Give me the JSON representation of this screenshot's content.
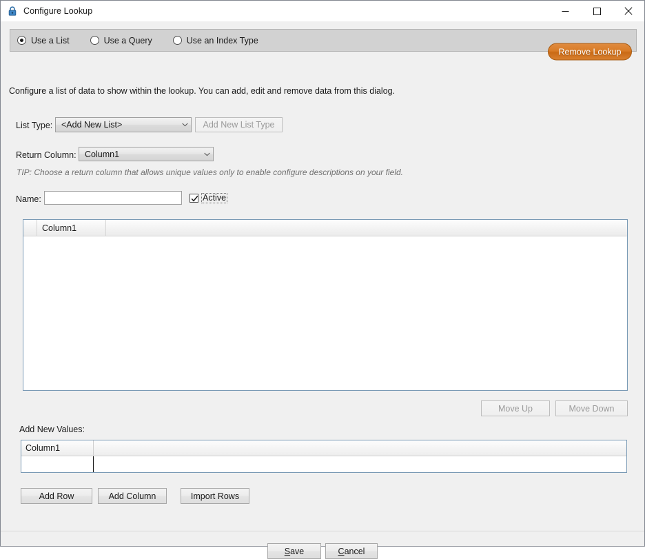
{
  "window": {
    "title": "Configure Lookup",
    "icon": "lock-icon",
    "controls": {
      "minimize": "minimize-icon",
      "maximize": "maximize-icon",
      "close": "close-icon"
    }
  },
  "mode_options": [
    {
      "label": "Use a List",
      "selected": true
    },
    {
      "label": "Use a Query",
      "selected": false
    },
    {
      "label": "Use an Index Type",
      "selected": false
    }
  ],
  "remove_lookup": {
    "label": "Remove Lookup",
    "color": "#d97c27"
  },
  "description": "Configure a list of data to show within the lookup. You can add, edit and remove data from this dialog.",
  "list_type": {
    "label": "List Type:",
    "value": "<Add New List>",
    "add_button": "Add New List Type",
    "add_button_enabled": false
  },
  "return_column": {
    "label": "Return Column:",
    "value": "Column1"
  },
  "tip": "TIP: Choose a return column that allows unique values only to enable configure descriptions on your field.",
  "name_field": {
    "label": "Name:",
    "value": "",
    "placeholder": ""
  },
  "active_checkbox": {
    "label": "Active",
    "checked": true
  },
  "main_grid": {
    "columns": [
      "Column1"
    ],
    "rows": []
  },
  "move_buttons": {
    "up": "Move Up",
    "down": "Move Down",
    "enabled": false
  },
  "add_new_values": {
    "label": "Add New Values:",
    "columns": [
      "Column1"
    ],
    "rows": [
      {
        "Column1": ""
      }
    ]
  },
  "row_buttons": {
    "add_row": "Add Row",
    "add_column": "Add Column",
    "import_rows": "Import Rows"
  },
  "footer": {
    "save": "Save",
    "save_accel": "S",
    "save_rest": "ave",
    "cancel": "Cancel",
    "cancel_accel": "C",
    "cancel_rest": "ancel"
  }
}
